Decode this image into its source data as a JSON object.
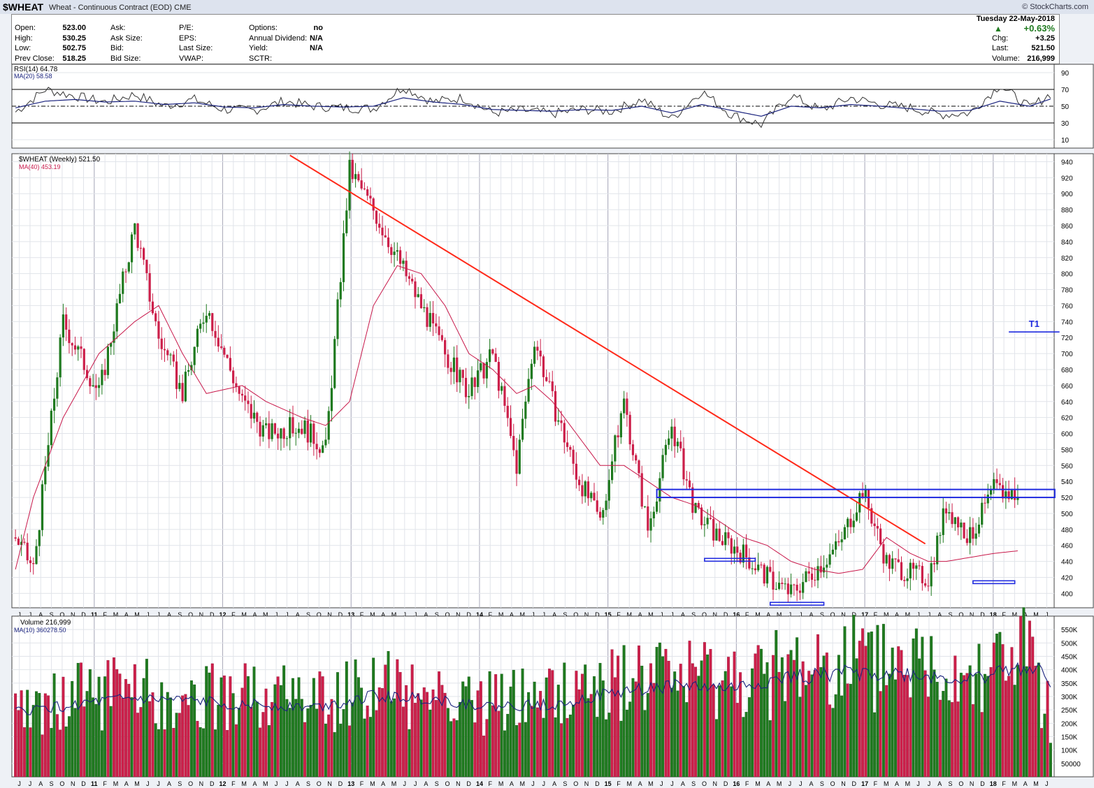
{
  "header": {
    "symbol": "$WHEAT",
    "description": "Wheat - Continuous Contract (EOD)",
    "exchange": "CME",
    "brand": "© StockCharts.com"
  },
  "quote": {
    "col1": [
      {
        "label": "Open:",
        "value": "523.00"
      },
      {
        "label": "High:",
        "value": "530.25"
      },
      {
        "label": "Low:",
        "value": "502.75"
      },
      {
        "label": "Prev Close:",
        "value": "518.25"
      }
    ],
    "col2": [
      "Ask:",
      "Ask Size:",
      "Bid:",
      "Bid Size:"
    ],
    "col3": [
      "P/E:",
      "EPS:",
      "Last Size:",
      "VWAP:"
    ],
    "col4": [
      {
        "label": "Options:",
        "value": "no"
      },
      {
        "label": "Annual Dividend:",
        "value": "N/A"
      },
      {
        "label": "Yield:",
        "value": "N/A"
      },
      {
        "label": "SCTR:",
        "value": ""
      }
    ],
    "date": "Tuesday 22-May-2018",
    "change_pct": "+0.63%",
    "right": [
      {
        "label": "Chg:",
        "value": "+3.25"
      },
      {
        "label": "Last:",
        "value": "521.50"
      },
      {
        "label": "Volume:",
        "value": "216,999"
      }
    ]
  },
  "colors": {
    "up": "#1f7a1f",
    "down": "#cc1f4a",
    "trendline": "#ff2a1a",
    "level": "#1f2adf",
    "ma_price": "#c8184a",
    "ma_rsi": "#1a237e"
  },
  "chart_data": [
    {
      "type": "line",
      "panel": "rsi",
      "legend": [
        "RSI(14) 64.78",
        "MA(20) 58.58"
      ],
      "ylim": [
        0,
        100
      ],
      "y_ticks": [
        90,
        70,
        50,
        30,
        10
      ],
      "reference_lines": [
        70,
        30
      ],
      "center_line": 50,
      "x_weeks": [
        0,
        10,
        20,
        30,
        40,
        50,
        60,
        70,
        80,
        90,
        100,
        110,
        120,
        130,
        140,
        150,
        160,
        170,
        180,
        190,
        200,
        210,
        220,
        230,
        240,
        250,
        260,
        270,
        280,
        290,
        300,
        310,
        320,
        330,
        340,
        347
      ],
      "series": [
        {
          "name": "RSI(14)",
          "values": [
            43,
            70,
            62,
            55,
            64,
            50,
            58,
            46,
            45,
            56,
            50,
            48,
            47,
            73,
            55,
            60,
            42,
            45,
            41,
            46,
            44,
            58,
            35,
            68,
            40,
            28,
            63,
            45,
            60,
            52,
            48,
            40,
            42,
            75,
            48,
            64.78
          ]
        },
        {
          "name": "MA(20)",
          "values": [
            48,
            56,
            58,
            55,
            56,
            52,
            54,
            49,
            48,
            52,
            50,
            49,
            50,
            60,
            55,
            52,
            46,
            45,
            44,
            46,
            45,
            50,
            42,
            52,
            45,
            38,
            50,
            48,
            52,
            50,
            47,
            44,
            45,
            56,
            50,
            58.58
          ]
        }
      ]
    },
    {
      "type": "bar",
      "panel": "price",
      "legend": [
        "$WHEAT (Weekly) 521.50",
        "MA(40) 453.19"
      ],
      "ylim": [
        382,
        950
      ],
      "y_ticks": [
        940,
        920,
        900,
        880,
        860,
        840,
        820,
        800,
        780,
        760,
        740,
        720,
        700,
        680,
        660,
        640,
        620,
        600,
        580,
        560,
        540,
        520,
        500,
        480,
        460,
        440,
        420,
        400
      ],
      "x_labels": [
        "J",
        "J",
        "A",
        "S",
        "O",
        "N",
        "D",
        "11",
        "F",
        "M",
        "A",
        "M",
        "J",
        "J",
        "A",
        "S",
        "O",
        "N",
        "D",
        "12",
        "F",
        "M",
        "A",
        "M",
        "J",
        "J",
        "A",
        "S",
        "O",
        "N",
        "D",
        "13",
        "F",
        "M",
        "A",
        "M",
        "J",
        "J",
        "A",
        "S",
        "O",
        "N",
        "D",
        "14",
        "F",
        "M",
        "A",
        "M",
        "J",
        "J",
        "A",
        "S",
        "O",
        "N",
        "D",
        "15",
        "F",
        "M",
        "A",
        "M",
        "J",
        "J",
        "A",
        "S",
        "O",
        "N",
        "D",
        "16",
        "F",
        "M",
        "A",
        "M",
        "J",
        "J",
        "A",
        "S",
        "O",
        "N",
        "D",
        "17",
        "F",
        "M",
        "A",
        "M",
        "J",
        "J",
        "A",
        "S",
        "O",
        "N",
        "D",
        "18",
        "F",
        "M",
        "A",
        "M",
        "J"
      ],
      "x_weeks": [
        0,
        6,
        16,
        28,
        40,
        48,
        56,
        64,
        76,
        84,
        96,
        104,
        112,
        120,
        128,
        136,
        144,
        152,
        160,
        168,
        174,
        180,
        188,
        196,
        204,
        212,
        220,
        228,
        236,
        244,
        252,
        260,
        268,
        276,
        284,
        292,
        300,
        306,
        312,
        320,
        328,
        336,
        342,
        347
      ],
      "series": [
        {
          "name": "$WHEAT",
          "values": [
            470,
            430,
            740,
            650,
            860,
            720,
            650,
            760,
            640,
            600,
            610,
            580,
            930,
            880,
            820,
            760,
            700,
            650,
            700,
            560,
            720,
            640,
            550,
            490,
            640,
            480,
            610,
            500,
            470,
            450,
            420,
            400,
            430,
            460,
            530,
            440,
            425,
            420,
            510,
            470,
            530,
            521.5
          ]
        },
        {
          "name": "MA(40)",
          "values": [
            430,
            520,
            620,
            700,
            740,
            760,
            700,
            650,
            660,
            640,
            620,
            610,
            640,
            760,
            810,
            800,
            760,
            700,
            680,
            650,
            660,
            640,
            600,
            560,
            560,
            540,
            520,
            510,
            490,
            470,
            460,
            440,
            430,
            425,
            430,
            470,
            450,
            440,
            440,
            445,
            450,
            453.19
          ]
        }
      ],
      "annotations": [
        {
          "type": "trendline",
          "from": {
            "week": 92,
            "value": 948
          },
          "to": {
            "week": 305,
            "value": 462
          }
        },
        {
          "type": "resistance_box",
          "from_week": 215,
          "to_week": 347,
          "range": [
            520,
            530
          ]
        },
        {
          "type": "support",
          "from_week": 231,
          "to_week": 248,
          "value": 442
        },
        {
          "type": "support",
          "from_week": 253,
          "to_week": 271,
          "value": 387
        },
        {
          "type": "support",
          "from_week": 321,
          "to_week": 335,
          "value": 414
        },
        {
          "type": "target",
          "label": "T1",
          "from_week": 333,
          "to_week": 350,
          "value": 727
        }
      ]
    },
    {
      "type": "bar",
      "panel": "volume",
      "legend": [
        "Volume 216,999",
        "MA(10) 360278.50"
      ],
      "ylim": [
        0,
        600000
      ],
      "y_ticks": [
        "550K",
        "500K",
        "450K",
        "400K",
        "350K",
        "300K",
        "250K",
        "200K",
        "150K",
        "100K",
        "50000"
      ],
      "x_labels": [
        "J",
        "J",
        "A",
        "S",
        "O",
        "N",
        "D",
        "11",
        "F",
        "M",
        "A",
        "M",
        "J",
        "J",
        "A",
        "S",
        "O",
        "N",
        "D",
        "12",
        "F",
        "M",
        "A",
        "M",
        "J",
        "J",
        "A",
        "S",
        "O",
        "N",
        "D",
        "13",
        "F",
        "M",
        "A",
        "M",
        "J",
        "J",
        "A",
        "S",
        "O",
        "N",
        "D",
        "14",
        "F",
        "M",
        "A",
        "M",
        "J",
        "J",
        "A",
        "S",
        "O",
        "N",
        "D",
        "15",
        "F",
        "M",
        "A",
        "M",
        "J",
        "J",
        "A",
        "S",
        "O",
        "N",
        "D",
        "16",
        "F",
        "M",
        "A",
        "M",
        "J",
        "J",
        "A",
        "S",
        "O",
        "N",
        "D",
        "17",
        "F",
        "M",
        "A",
        "M",
        "J",
        "J",
        "A",
        "S",
        "O",
        "N",
        "D",
        "18",
        "F",
        "M",
        "A",
        "M",
        "J"
      ],
      "x_weeks": [
        0,
        20,
        40,
        60,
        80,
        100,
        120,
        140,
        160,
        180,
        200,
        220,
        240,
        260,
        280,
        300,
        320,
        340,
        347
      ],
      "series": [
        {
          "name": "Volume",
          "values": [
            260000,
            300000,
            320000,
            290000,
            300000,
            280000,
            330000,
            310000,
            270000,
            290000,
            340000,
            360000,
            350000,
            390000,
            420000,
            410000,
            380000,
            450000,
            216999
          ]
        },
        {
          "name": "MA(10)",
          "values": [
            240000,
            270000,
            290000,
            280000,
            270000,
            260000,
            300000,
            290000,
            260000,
            270000,
            310000,
            340000,
            330000,
            370000,
            390000,
            380000,
            360000,
            420000,
            360278.5
          ]
        }
      ]
    }
  ]
}
